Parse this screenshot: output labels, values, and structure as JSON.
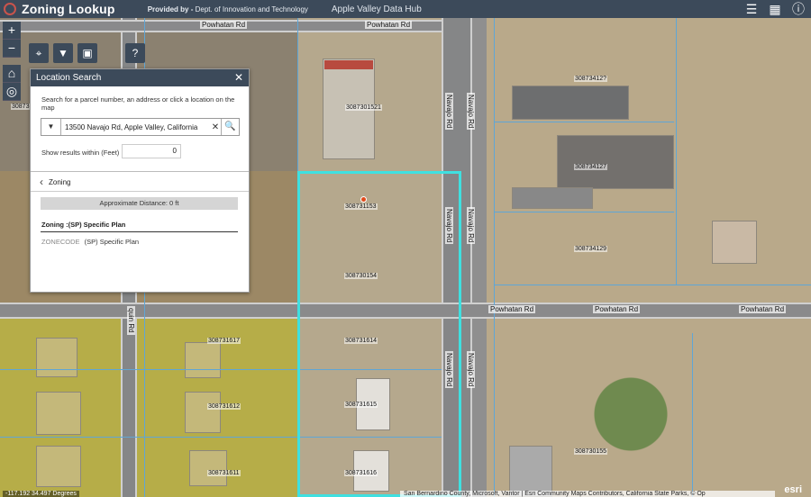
{
  "header": {
    "title": "Zoning Lookup",
    "provided_prefix": "Provided by -",
    "provided_org": "Dept. of Innovation and Technology",
    "hub": "Apple Valley Data Hub",
    "icons": [
      "list-icon",
      "grid-icon",
      "info-icon"
    ]
  },
  "zoom": {
    "plus": "+",
    "minus": "−"
  },
  "panel": {
    "title": "Location Search",
    "description": "Search for a parcel number, an address or click a location on the map",
    "search_value": "13500 Navajo Rd, Apple Valley, California",
    "within_label": "Show results within (Feet)",
    "within_value": "0",
    "back_label": "Zoning",
    "distance": "Approximate Distance: 0 ft",
    "zone_heading": "Zoning :(SP) Specific Plan",
    "zone_key": "ZONECODE",
    "zone_value": "(SP) Specific Plan"
  },
  "roads": {
    "powhatan": "Powhatan Rd",
    "navajo": "Navajo Rd",
    "quin": "quin Rd"
  },
  "parcels": [
    "3087301521",
    "30873412?",
    "308734127",
    "308731153",
    "308734129",
    "308730154",
    "308731614",
    "308731615",
    "308731616",
    "308731617",
    "308731612",
    "308731611",
    "308730155",
    "3087314"
  ],
  "footer": {
    "coords": "-117.192 34.497 Degrees",
    "attribution": "San Bernardino County, Microsoft, Vantor | Esri Community Maps Contributors, California State Parks, © Op",
    "powered": "esri"
  }
}
